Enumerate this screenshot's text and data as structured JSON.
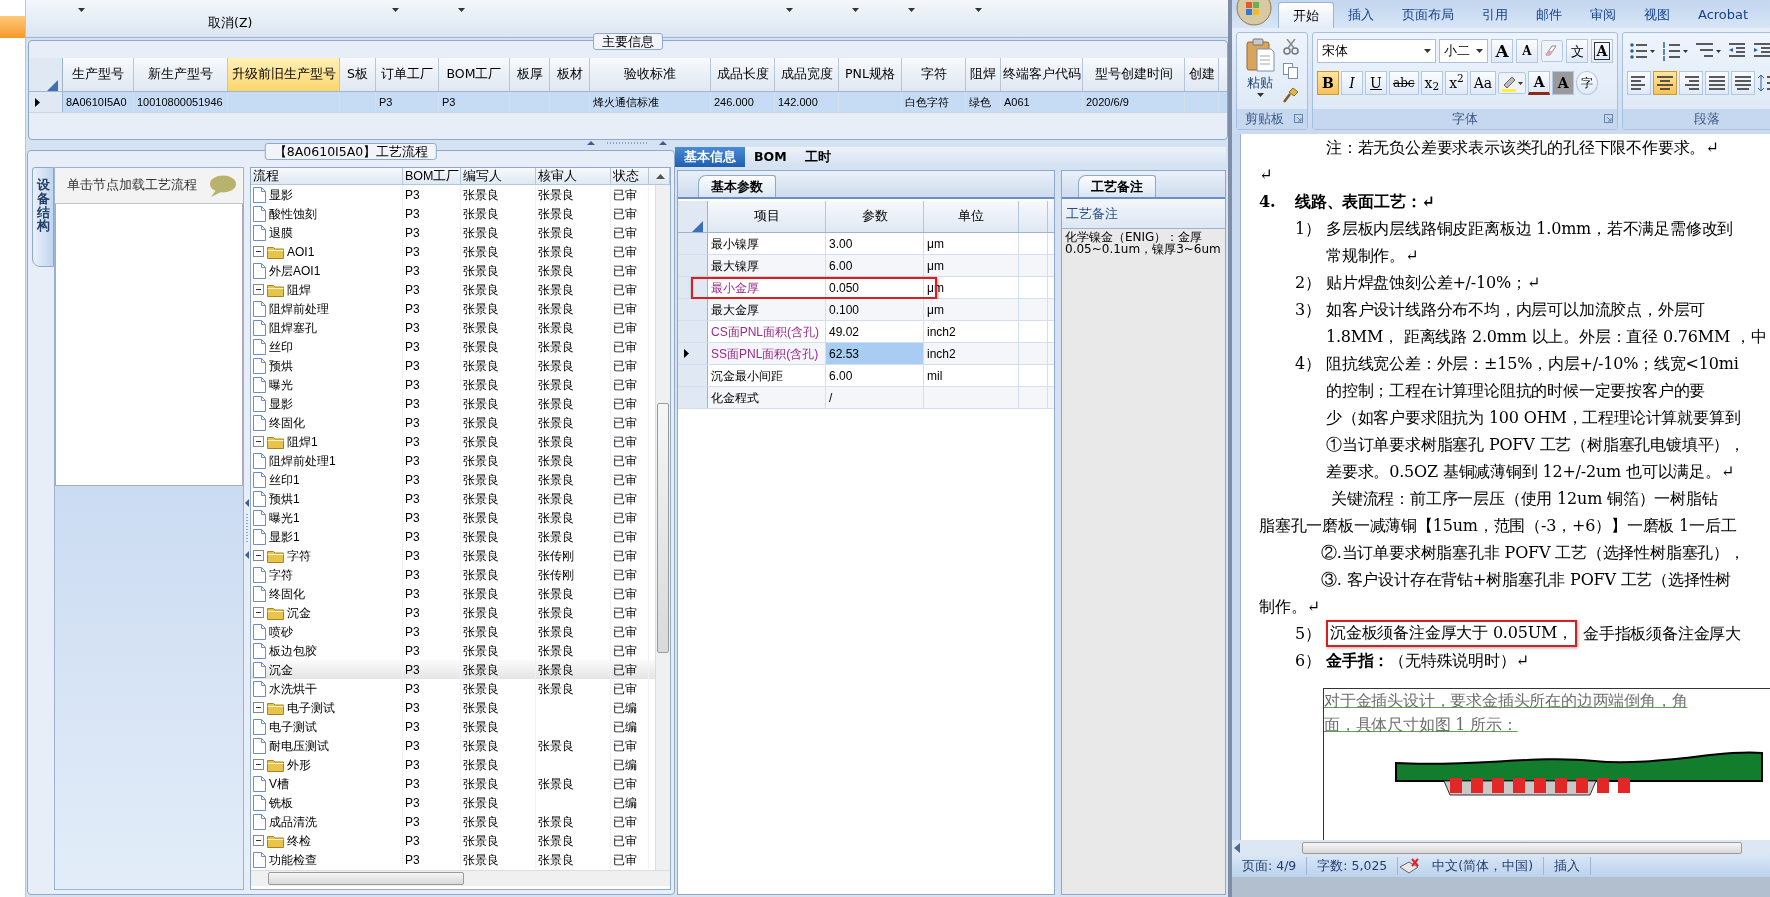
{
  "toolbar": {
    "label": "取消(Z)"
  },
  "main_info": {
    "title": "主要信息",
    "columns": [
      {
        "label": "生产型号",
        "highlighted": false
      },
      {
        "label": "新生产型号",
        "highlighted": false
      },
      {
        "label": "升级前旧生产型号",
        "highlighted": true
      },
      {
        "label": "S板",
        "highlighted": false
      },
      {
        "label": "订单工厂",
        "highlighted": false
      },
      {
        "label": "BOM工厂",
        "highlighted": false
      },
      {
        "label": "板厚",
        "highlighted": false
      },
      {
        "label": "板材",
        "highlighted": false
      },
      {
        "label": "验收标准",
        "highlighted": false
      },
      {
        "label": "成品长度",
        "highlighted": false
      },
      {
        "label": "成品宽度",
        "highlighted": false
      },
      {
        "label": "PNL规格",
        "highlighted": false
      },
      {
        "label": "字符",
        "highlighted": false
      },
      {
        "label": "阻焊",
        "highlighted": false
      },
      {
        "label": "终端客户代码",
        "highlighted": false
      },
      {
        "label": "型号创建时间",
        "highlighted": false
      },
      {
        "label": "创建",
        "highlighted": false
      }
    ],
    "rows": [
      {
        "selected": true,
        "cells": [
          "8A0610I5A0",
          "10010800051946",
          null,
          null,
          "P3",
          "P3",
          null,
          null,
          "烽火通信标准",
          "246.000",
          "142.000",
          null,
          "白色字符",
          "绿色",
          "A061",
          "2020/6/9",
          null
        ]
      }
    ]
  },
  "process": {
    "title": "【8A0610I5A0】工艺流程",
    "side_tab": "设备结构",
    "hint": "单击节点加载工艺流程",
    "columns": [
      "流程",
      "BOM工厂",
      "编写人",
      "核审人",
      "状态"
    ],
    "tree": [
      {
        "kind": "step",
        "label": "显影",
        "bom": "P3",
        "author": "张景良",
        "reviewer": "张景良",
        "status": "已审",
        "selected": false
      },
      {
        "kind": "step",
        "label": "酸性蚀刻",
        "bom": "P3",
        "author": "张景良",
        "reviewer": "张景良",
        "status": "已审",
        "selected": false
      },
      {
        "kind": "step",
        "label": "退膜",
        "bom": "P3",
        "author": "张景良",
        "reviewer": "张景良",
        "status": "已审",
        "selected": false
      },
      {
        "kind": "folder",
        "label": "AOI1",
        "bom": "P3",
        "author": "张景良",
        "reviewer": "张景良",
        "status": "已审",
        "selected": false,
        "expanded": true,
        "children": [
          {
            "kind": "step",
            "label": "外层AOI1",
            "bom": "P3",
            "author": "张景良",
            "reviewer": "张景良",
            "status": "已审",
            "selected": false
          }
        ]
      },
      {
        "kind": "folder",
        "label": "阻焊",
        "bom": "P3",
        "author": "张景良",
        "reviewer": "张景良",
        "status": "已审",
        "selected": false,
        "expanded": true,
        "children": [
          {
            "kind": "step",
            "label": "阻焊前处理",
            "bom": "P3",
            "author": "张景良",
            "reviewer": "张景良",
            "status": "已审",
            "selected": false
          },
          {
            "kind": "step",
            "label": "阻焊塞孔",
            "bom": "P3",
            "author": "张景良",
            "reviewer": "张景良",
            "status": "已审",
            "selected": false
          },
          {
            "kind": "step",
            "label": "丝印",
            "bom": "P3",
            "author": "张景良",
            "reviewer": "张景良",
            "status": "已审",
            "selected": false
          },
          {
            "kind": "step",
            "label": "预烘",
            "bom": "P3",
            "author": "张景良",
            "reviewer": "张景良",
            "status": "已审",
            "selected": false
          },
          {
            "kind": "step",
            "label": "曝光",
            "bom": "P3",
            "author": "张景良",
            "reviewer": "张景良",
            "status": "已审",
            "selected": false
          },
          {
            "kind": "step",
            "label": "显影",
            "bom": "P3",
            "author": "张景良",
            "reviewer": "张景良",
            "status": "已审",
            "selected": false
          },
          {
            "kind": "step",
            "label": "终固化",
            "bom": "P3",
            "author": "张景良",
            "reviewer": "张景良",
            "status": "已审",
            "selected": false
          }
        ]
      },
      {
        "kind": "folder",
        "label": "阻焊1",
        "bom": "P3",
        "author": "张景良",
        "reviewer": "张景良",
        "status": "已审",
        "selected": false,
        "expanded": true,
        "children": [
          {
            "kind": "step",
            "label": "阻焊前处理1",
            "bom": "P3",
            "author": "张景良",
            "reviewer": "张景良",
            "status": "已审",
            "selected": false
          },
          {
            "kind": "step",
            "label": "丝印1",
            "bom": "P3",
            "author": "张景良",
            "reviewer": "张景良",
            "status": "已审",
            "selected": false
          },
          {
            "kind": "step",
            "label": "预烘1",
            "bom": "P3",
            "author": "张景良",
            "reviewer": "张景良",
            "status": "已审",
            "selected": false
          },
          {
            "kind": "step",
            "label": "曝光1",
            "bom": "P3",
            "author": "张景良",
            "reviewer": "张景良",
            "status": "已审",
            "selected": false
          },
          {
            "kind": "step",
            "label": "显影1",
            "bom": "P3",
            "author": "张景良",
            "reviewer": "张景良",
            "status": "已审",
            "selected": false
          }
        ]
      },
      {
        "kind": "folder",
        "label": "字符",
        "bom": "P3",
        "author": "张景良",
        "reviewer": "张传刚",
        "status": "已审",
        "selected": false,
        "expanded": true,
        "children": [
          {
            "kind": "step",
            "label": "字符",
            "bom": "P3",
            "author": "张景良",
            "reviewer": "张传刚",
            "status": "已审",
            "selected": false
          },
          {
            "kind": "step",
            "label": "终固化",
            "bom": "P3",
            "author": "张景良",
            "reviewer": "张景良",
            "status": "已审",
            "selected": false
          }
        ]
      },
      {
        "kind": "folder",
        "label": "沉金",
        "bom": "P3",
        "author": "张景良",
        "reviewer": "张景良",
        "status": "已审",
        "selected": false,
        "expanded": true,
        "children": [
          {
            "kind": "step",
            "label": "喷砂",
            "bom": "P3",
            "author": "张景良",
            "reviewer": "张景良",
            "status": "已审",
            "selected": false
          },
          {
            "kind": "step",
            "label": "板边包胶",
            "bom": "P3",
            "author": "张景良",
            "reviewer": "张景良",
            "status": "已审",
            "selected": false
          },
          {
            "kind": "step",
            "label": "沉金",
            "bom": "P3",
            "author": "张景良",
            "reviewer": "张景良",
            "status": "已审",
            "selected": true
          },
          {
            "kind": "step",
            "label": "水洗烘干",
            "bom": "P3",
            "author": "张景良",
            "reviewer": "张景良",
            "status": "已审",
            "selected": false
          }
        ]
      },
      {
        "kind": "folder",
        "label": "电子测试",
        "bom": "P3",
        "author": "张景良",
        "status": "已编",
        "selected": false,
        "expanded": true,
        "children": [
          {
            "kind": "step",
            "label": "电子测试",
            "bom": "P3",
            "author": "张景良",
            "status": "已编",
            "selected": false
          },
          {
            "kind": "step",
            "label": "耐电压测试",
            "bom": "P3",
            "author": "张景良",
            "reviewer": "张景良",
            "status": "已审",
            "selected": false
          }
        ]
      },
      {
        "kind": "folder",
        "label": "外形",
        "bom": "P3",
        "author": "张景良",
        "status": "已编",
        "selected": false,
        "expanded": true,
        "children": [
          {
            "kind": "step",
            "label": "V槽",
            "bom": "P3",
            "author": "张景良",
            "reviewer": "张景良",
            "status": "已审",
            "selected": false
          },
          {
            "kind": "step",
            "label": "铣板",
            "bom": "P3",
            "author": "张景良",
            "status": "已编",
            "selected": false
          },
          {
            "kind": "step",
            "label": "成品清洗",
            "bom": "P3",
            "author": "张景良",
            "reviewer": "张景良",
            "status": "已审",
            "selected": false
          }
        ]
      },
      {
        "kind": "folder",
        "label": "终检",
        "bom": "P3",
        "author": "张景良",
        "reviewer": "张景良",
        "status": "已审",
        "selected": false,
        "expanded": true,
        "children": [
          {
            "kind": "step",
            "label": "功能检查",
            "bom": "P3",
            "author": "张景良",
            "reviewer": "张景良",
            "status": "已审",
            "selected": false
          }
        ]
      }
    ]
  },
  "detail": {
    "tabs": [
      {
        "label": "基本信息",
        "selected": true
      },
      {
        "label": "BOM",
        "selected": false
      },
      {
        "label": "工时",
        "selected": false
      }
    ],
    "params": {
      "tab": "基本参数",
      "columns": [
        "项目",
        "参数",
        "单位"
      ],
      "rows": [
        {
          "item": "最小镍厚",
          "value": "3.00",
          "unit": "μm",
          "highlighted": false,
          "current": false,
          "annotated": false
        },
        {
          "item": "最大镍厚",
          "value": "6.00",
          "unit": "μm",
          "highlighted": false,
          "current": false,
          "annotated": false
        },
        {
          "item": "最小金厚",
          "value": "0.050",
          "unit": "μm",
          "highlighted": true,
          "current": false,
          "annotated": true
        },
        {
          "item": "最大金厚",
          "value": "0.100",
          "unit": "μm",
          "highlighted": false,
          "current": false,
          "annotated": false
        },
        {
          "item": "CS面PNL面积(含孔)",
          "value": "49.02",
          "unit": "inch2",
          "highlighted": true,
          "current": false,
          "annotated": false
        },
        {
          "item": "SS面PNL面积(含孔)",
          "value": "62.53",
          "unit": "inch2",
          "highlighted": true,
          "current": true,
          "annotated": false
        },
        {
          "item": "沉金最小间距",
          "value": "6.00",
          "unit": "mil",
          "highlighted": false,
          "current": false,
          "annotated": false
        },
        {
          "item": "化金程式",
          "value": "/",
          "highlighted": false,
          "current": false,
          "annotated": false
        }
      ]
    },
    "notes": {
      "tab": "工艺备注",
      "header": "工艺备注",
      "text": "化学镍金（ENIG）：金厚0.05~0.1um，镍厚3~6um"
    }
  },
  "word": {
    "tabs": [
      {
        "label": "开始",
        "selected": true
      },
      {
        "label": "插入",
        "selected": false
      },
      {
        "label": "页面布局",
        "selected": false
      },
      {
        "label": "引用",
        "selected": false
      },
      {
        "label": "邮件",
        "selected": false
      },
      {
        "label": "审阅",
        "selected": false
      },
      {
        "label": "视图",
        "selected": false
      },
      {
        "label": "Acrobat",
        "selected": false
      }
    ],
    "ribbon": {
      "paste": "粘贴",
      "clipboard_label": "剪贴板",
      "font_name": "宋体",
      "font_size": "小二",
      "font_label": "字体",
      "paragraph_label": "段落",
      "font_row1": [
        {
          "kind": "grow",
          "label": "A",
          "on": false
        },
        {
          "kind": "shrink",
          "label": "A",
          "on": false
        },
        {
          "kind": "clear"
        },
        {
          "kind": "phonetic",
          "label": "文",
          "on": false
        },
        {
          "kind": "border",
          "label": "A",
          "on": false
        }
      ],
      "font_row2": [
        {
          "kind": "bold",
          "label": "B",
          "on": true
        },
        {
          "kind": "italic",
          "label": "I",
          "on": false
        },
        {
          "kind": "underline",
          "label": "U",
          "on": false
        },
        {
          "kind": "strike",
          "label": "abc",
          "on": false
        },
        {
          "kind": "sub",
          "label": "x$_{2}$",
          "on": false
        },
        {
          "kind": "sup",
          "label": "x$^{2}$",
          "on": false
        },
        {
          "kind": "case",
          "label": "Aa",
          "on": false
        },
        {
          "kind": "highlight"
        },
        {
          "kind": "color",
          "label": "A",
          "on": false
        },
        {
          "kind": "shading",
          "label": "A",
          "on": false
        },
        {
          "kind": "enclose",
          "label": "字",
          "on": false
        }
      ],
      "align_buttons": [
        {
          "kind": "left",
          "selected": false
        },
        {
          "kind": "center",
          "selected": true
        },
        {
          "kind": "right",
          "selected": false
        },
        {
          "kind": "justify",
          "selected": false
        },
        {
          "kind": "distribute",
          "selected": false
        }
      ]
    },
    "doc": [
      {
        "kind": "cont",
        "text": "注：若无负公差要求表示该类孔的孔径下限不作要求。↵"
      },
      {
        "kind": "flush",
        "text": "↵"
      },
      {
        "kind": "heading",
        "num": "4.",
        "text": "线路、表面工艺：↵"
      },
      {
        "kind": "item",
        "num": "1）",
        "text": "多层板内层线路铜皮距离板边 1.0mm，若不满足需修改到"
      },
      {
        "kind": "cont",
        "text": "常规制作。↵"
      },
      {
        "kind": "item",
        "num": "2）",
        "text": "贴片焊盘蚀刻公差+/-10%；↵"
      },
      {
        "kind": "item",
        "num": "3）",
        "text": "如客户设计线路分布不均，内层可以加流胶点，外层可"
      },
      {
        "kind": "cont",
        "text": "1.8MM， 距离线路 2.0mm 以上。外层：直径 0.76MM ，中"
      },
      {
        "kind": "item",
        "num": "4）",
        "text": "阻抗线宽公差：外层：±15%，内层+/-10%；线宽<10mi"
      },
      {
        "kind": "cont",
        "text": "的控制；工程在计算理论阻抗的时候一定要按客户的要"
      },
      {
        "kind": "cont",
        "text": "少（如客户要求阻抗为 100 OHM，工程理论计算就要算到"
      },
      {
        "kind": "cont",
        "text": "①当订单要求树脂塞孔 POFV 工艺（树脂塞孔电镀填平），"
      },
      {
        "kind": "cont",
        "text": "差要求。0.5OZ 基铜减薄铜到 12+/-2um 也可以满足。↵"
      },
      {
        "kind": "flow",
        "text": "关键流程：前工序一层压（使用 12um 铜箔）一树脂钻"
      },
      {
        "kind": "flush",
        "text": "脂塞孔一磨板一减薄铜【15um，范围（-3，+6）】一磨板 1一后工"
      },
      {
        "kind": "sub",
        "text": "②.当订单要求树脂塞孔非 POFV 工艺（选择性树脂塞孔），"
      },
      {
        "kind": "sub",
        "text": "③. 客户设计存在背钻+树脂塞孔非 POFV 工艺（选择性树"
      },
      {
        "kind": "flush",
        "text": "制作。↵"
      },
      {
        "kind": "item",
        "num": "5）",
        "boxed": "沉金板须备注金厚大于 0.05UM，",
        "text": "金手指板须备注金厚大"
      },
      {
        "kind": "item",
        "num": "6）",
        "text": "**金手指：**（无特殊说明时）↵"
      }
    ],
    "figure": {
      "lines": [
        "对于金插头设计，要求金插头所在的边两端倒角，角",
        "面，具体尺寸如图 1 所示："
      ]
    },
    "status": [
      "页面: 4/9",
      "字数: 5,025",
      "中文(简体，中国)",
      "插入"
    ]
  }
}
